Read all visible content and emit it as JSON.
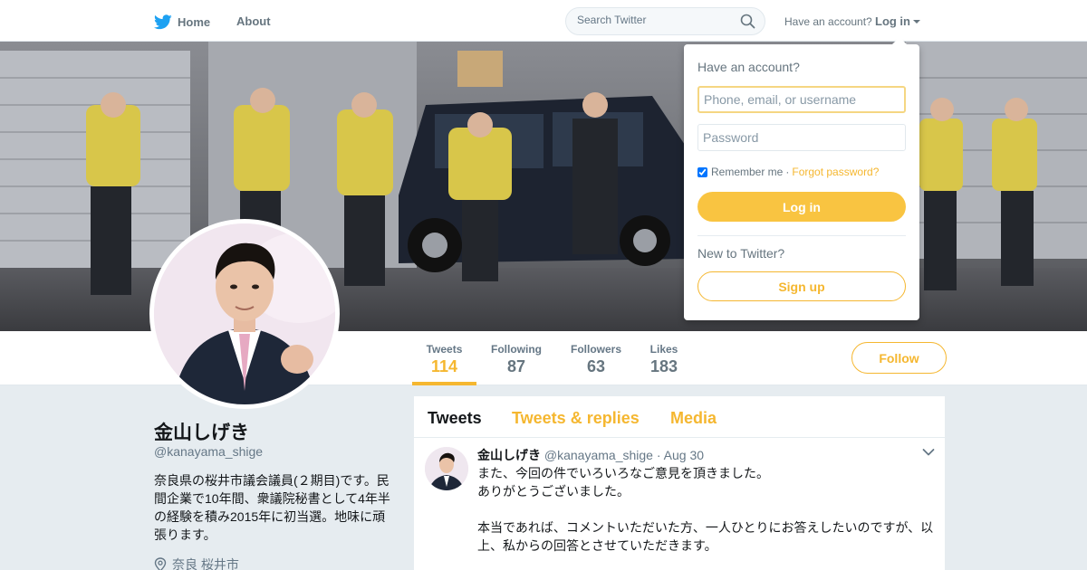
{
  "nav": {
    "home_label": "Home",
    "about_label": "About",
    "search_placeholder": "Search Twitter",
    "have_account": "Have an account?",
    "login_label": "Log in",
    "brand_color": "#1da1f2",
    "accent_color": "#f5b730",
    "icons": [
      "twitter-bird-icon",
      "search-icon",
      "caret-down-icon"
    ]
  },
  "profile": {
    "name": "金山しげき",
    "handle": "@kanayama_shige",
    "bio": "奈良県の桜井市議会議員(２期目)です。民間企業で10年間、衆議院秘書として4年半の経験を積み2015年に初当選。地味に頑張ります。",
    "location": "奈良 桜井市",
    "follow_label": "Follow"
  },
  "stats": [
    {
      "label": "Tweets",
      "value": "114",
      "active": true
    },
    {
      "label": "Following",
      "value": "87"
    },
    {
      "label": "Followers",
      "value": "63"
    },
    {
      "label": "Likes",
      "value": "183"
    }
  ],
  "timeline": {
    "tabs": [
      "Tweets",
      "Tweets & replies",
      "Media"
    ],
    "tweet": {
      "name": "金山しげき",
      "handle": "@kanayama_shige",
      "separator": "·",
      "date": "Aug 30",
      "lines": [
        "また、今回の件でいろいろなご意見を頂きました。",
        "ありがとうございました。",
        "",
        "本当であれば、コメントいただいた方、一人ひとりにお答えしたいのですが、以上、私からの回答とさせていただきます。"
      ]
    }
  },
  "login_dropdown": {
    "title": "Have an account?",
    "username_placeholder": "Phone, email, or username",
    "password_placeholder": "Password",
    "remember_label": "Remember me",
    "separator": "·",
    "forgot_label": "Forgot password?",
    "login_button": "Log in",
    "new_label": "New to Twitter?",
    "signup_button": "Sign up"
  }
}
